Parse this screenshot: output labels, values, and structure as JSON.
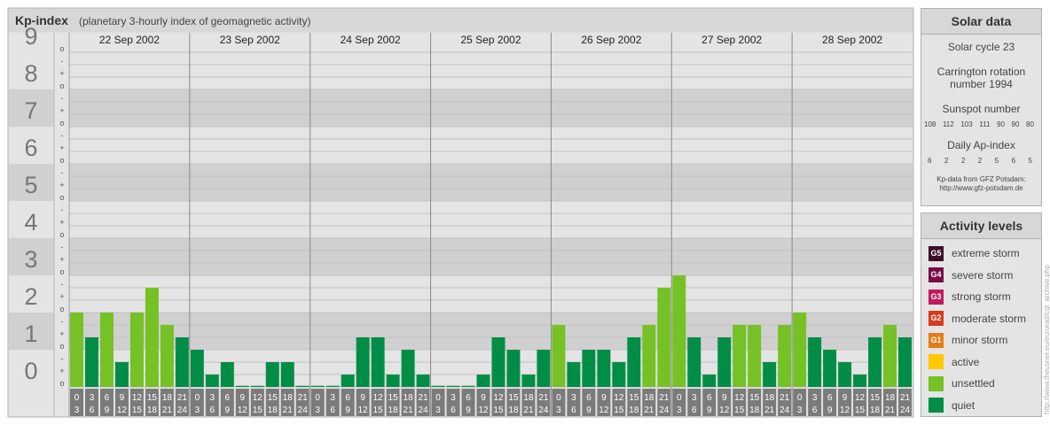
{
  "header": {
    "title": "Kp-index",
    "subtitle": "(planetary 3-hourly index of geomagnetic activity)"
  },
  "chart_data": {
    "type": "bar",
    "title": "Kp-index",
    "subtitle": "(planetary 3-hourly index of geomagnetic activity)",
    "ylim": [
      0,
      9
    ],
    "y_ticks": [
      "0",
      "1",
      "2",
      "3",
      "4",
      "5",
      "6",
      "7",
      "8",
      "9"
    ],
    "y_minor_ticks": [
      "o",
      "+",
      "-"
    ],
    "dates": [
      "22 Sep 2002",
      "23 Sep 2002",
      "24 Sep 2002",
      "25 Sep 2002",
      "26 Sep 2002",
      "27 Sep 2002",
      "28 Sep 2002"
    ],
    "interval_labels": [
      [
        "0",
        "3"
      ],
      [
        "3",
        "6"
      ],
      [
        "6",
        "9"
      ],
      [
        "9",
        "12"
      ],
      [
        "12",
        "15"
      ],
      [
        "15",
        "18"
      ],
      [
        "18",
        "21"
      ],
      [
        "21",
        "24"
      ]
    ],
    "values": [
      [
        2.0,
        1.333,
        2.0,
        0.667,
        2.0,
        2.667,
        1.667,
        1.333
      ],
      [
        1.0,
        0.333,
        0.667,
        0.0,
        0.0,
        0.667,
        0.667,
        0.0
      ],
      [
        0.0,
        0.0,
        0.333,
        1.333,
        1.333,
        0.333,
        1.0,
        0.333
      ],
      [
        0.0,
        0.0,
        0.0,
        0.333,
        1.333,
        1.0,
        0.333,
        1.0
      ],
      [
        1.667,
        0.667,
        1.0,
        1.0,
        0.667,
        1.333,
        1.667,
        2.667
      ],
      [
        3.0,
        1.333,
        0.333,
        1.333,
        1.667,
        1.667,
        0.667,
        1.667
      ],
      [
        2.0,
        1.333,
        1.0,
        0.667,
        0.333,
        1.333,
        1.667,
        1.333
      ]
    ],
    "level_colors": {
      "quiet": "#028d47",
      "unsettled": "#76c125",
      "active": "#ffc800",
      "G1": "#e77b15",
      "G2": "#d73a1c",
      "G3": "#c2195f",
      "G4": "#7a0c47",
      "G5": "#3d0d26"
    },
    "grid": true
  },
  "solar": {
    "title": "Solar data",
    "cycle": "Solar cycle 23",
    "carrington_line1": "Carrington rotation",
    "carrington_line2": "number 1994",
    "sunspot_title": "Sunspot number",
    "sunspot_values": [
      "108",
      "112",
      "103",
      "111",
      "90",
      "90",
      "80"
    ],
    "ap_title": "Daily Ap-index",
    "ap_values": [
      "6",
      "2",
      "2",
      "2",
      "5",
      "6",
      "5"
    ],
    "credit_line1": "Kp-data from GFZ Potsdam:",
    "credit_line2": "http://www.gfz-potsdam.de"
  },
  "activity": {
    "title": "Activity levels",
    "levels": [
      {
        "badge": "G5",
        "label": "extreme storm",
        "color": "#3d0d26"
      },
      {
        "badge": "G4",
        "label": "severe storm",
        "color": "#7a0c47"
      },
      {
        "badge": "G3",
        "label": "strong storm",
        "color": "#c2195f"
      },
      {
        "badge": "G2",
        "label": "moderate storm",
        "color": "#d73a1c"
      },
      {
        "badge": "G1",
        "label": "minor storm",
        "color": "#e77b15"
      },
      {
        "badge": "",
        "label": "active",
        "color": "#ffc800"
      },
      {
        "badge": "",
        "label": "unsettled",
        "color": "#76c125"
      },
      {
        "badge": "",
        "label": "quiet",
        "color": "#028d47"
      }
    ]
  },
  "side_credit": "http://www.theusner.eu/eurorad/cgi_archive.php"
}
